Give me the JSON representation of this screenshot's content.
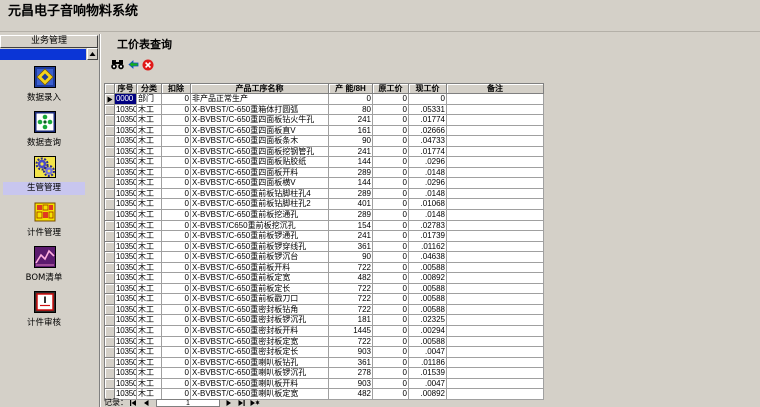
{
  "app": {
    "title": "元昌电子音响物料系统"
  },
  "colors": {
    "window_bg": "#d4d0c8",
    "selection_highlight": "#c8c6ef",
    "group_bar": "#0b35d6",
    "grid_line": "#a0a0a0",
    "selected_cell_bg": "#000080"
  },
  "sidebar": {
    "group_header": "业务管理",
    "items": [
      {
        "label": "数据录入",
        "icon": "data-entry-icon"
      },
      {
        "label": "数据查询",
        "icon": "data-query-icon"
      },
      {
        "label": "生管管理",
        "icon": "production-gears-icon",
        "selected": true
      },
      {
        "label": "计件管理",
        "icon": "piecework-blocks-icon"
      },
      {
        "label": "BOM清单",
        "icon": "bom-chart-icon"
      },
      {
        "label": "计件审核",
        "icon": "audit-box-icon"
      }
    ]
  },
  "form": {
    "title": "工价表查询",
    "toolbar": [
      {
        "icon": "binoculars-icon"
      },
      {
        "icon": "green-back-arrow-icon"
      },
      {
        "icon": "red-close-icon"
      }
    ]
  },
  "table": {
    "columns": [
      "序号",
      "分类",
      "扣除",
      "产品工序名称",
      "产 能/8H",
      "原工价",
      "现工价",
      "备注"
    ],
    "current_row": 0,
    "rows": [
      [
        "0000",
        "部门",
        "0",
        "非产品正常生产",
        "0",
        "0",
        "0"
      ],
      [
        "10350",
        "木工",
        "0",
        "X-BVBST/C-650重箱体打圆弧",
        "80",
        "0",
        ".05331"
      ],
      [
        "10350",
        "木工",
        "0",
        "X-BVBST/C-650重四面板钻火牛孔",
        "241",
        "0",
        ".01774"
      ],
      [
        "10350",
        "木工",
        "0",
        "X-BVBST/C-650重四面板直V",
        "161",
        "0",
        ".02666"
      ],
      [
        "10350",
        "木工",
        "0",
        "X-BVBST/C-650重四面板条木",
        "90",
        "0",
        ".04733"
      ],
      [
        "10350",
        "木工",
        "0",
        "X-BVBST/C-650重四面板挖钢管孔",
        "241",
        "0",
        ".01774"
      ],
      [
        "10350",
        "木工",
        "0",
        "X-BVBST/C-650重四面板贴胶纸",
        "144",
        "0",
        ".0296"
      ],
      [
        "10350",
        "木工",
        "0",
        "X-BVBST/C-650重四面板开料",
        "289",
        "0",
        ".0148"
      ],
      [
        "10350",
        "木工",
        "0",
        "X-BVBST/C-650重四面板横V",
        "144",
        "0",
        ".0296"
      ],
      [
        "10350",
        "木工",
        "0",
        "X-BVBST/C-650重前板钻脚柱孔4",
        "289",
        "0",
        ".0148"
      ],
      [
        "10350",
        "木工",
        "0",
        "X-BVBST/C-650重前板钻脚柱孔2",
        "401",
        "0",
        ".01068"
      ],
      [
        "10350",
        "木工",
        "0",
        "X-BVBST/C-650重前板挖通孔",
        "289",
        "0",
        ".0148"
      ],
      [
        "10350",
        "木工",
        "0",
        "X-BVBST/C650重前板挖沉孔",
        "154",
        "0",
        ".02783"
      ],
      [
        "10350",
        "木工",
        "0",
        "X-BVBST/C-650重前板锣通孔",
        "241",
        "0",
        ".01739"
      ],
      [
        "10350",
        "木工",
        "0",
        "X-BVBST/C-650重前板锣穿线孔",
        "361",
        "0",
        ".01162"
      ],
      [
        "10350",
        "木工",
        "0",
        "X-BVBST/C-650重前板锣沉台",
        "90",
        "0",
        ".04638"
      ],
      [
        "10350",
        "木工",
        "0",
        "X-BVBST/C-650重前板开料",
        "722",
        "0",
        ".00588"
      ],
      [
        "10350",
        "木工",
        "0",
        "X-BVBST/C-650重前板定宽",
        "482",
        "0",
        ".00892"
      ],
      [
        "10350",
        "木工",
        "0",
        "X-BVBST/C-650重前板定长",
        "722",
        "0",
        ".00588"
      ],
      [
        "10350",
        "木工",
        "0",
        "X-BVBST/C-650重前板戳刀口",
        "722",
        "0",
        ".00588"
      ],
      [
        "10350",
        "木工",
        "0",
        "X-BVBST/C-650重密封板钻角",
        "722",
        "0",
        ".00588"
      ],
      [
        "10350",
        "木工",
        "0",
        "X-BVBST/C-650重密封板锣沉孔",
        "181",
        "0",
        ".02325"
      ],
      [
        "10350",
        "木工",
        "0",
        "X-BVBST/C-650重密封板开料",
        "1445",
        "0",
        ".00294"
      ],
      [
        "10350",
        "木工",
        "0",
        "X-BVBST/C-650重密封板定宽",
        "722",
        "0",
        ".00588"
      ],
      [
        "10350",
        "木工",
        "0",
        "X-BVBST/C-650重密封板定长",
        "903",
        "0",
        ".0047"
      ],
      [
        "10350",
        "木工",
        "0",
        "X-BVBST/C-650重喇叭板钻孔",
        "361",
        "0",
        ".01186"
      ],
      [
        "10350",
        "木工",
        "0",
        "X-BVBST/C-650重喇叭板锣沉孔",
        "278",
        "0",
        ".01539"
      ],
      [
        "10350",
        "木工",
        "0",
        "X-BVBST/C-650重喇叭板开料",
        "903",
        "0",
        ".0047"
      ],
      [
        "10350",
        "木工",
        "0",
        "X-BVBST/C-650重喇叭板定宽",
        "482",
        "0",
        ".00892"
      ]
    ]
  },
  "navigator": {
    "label": "记录：",
    "current_record": "1"
  }
}
